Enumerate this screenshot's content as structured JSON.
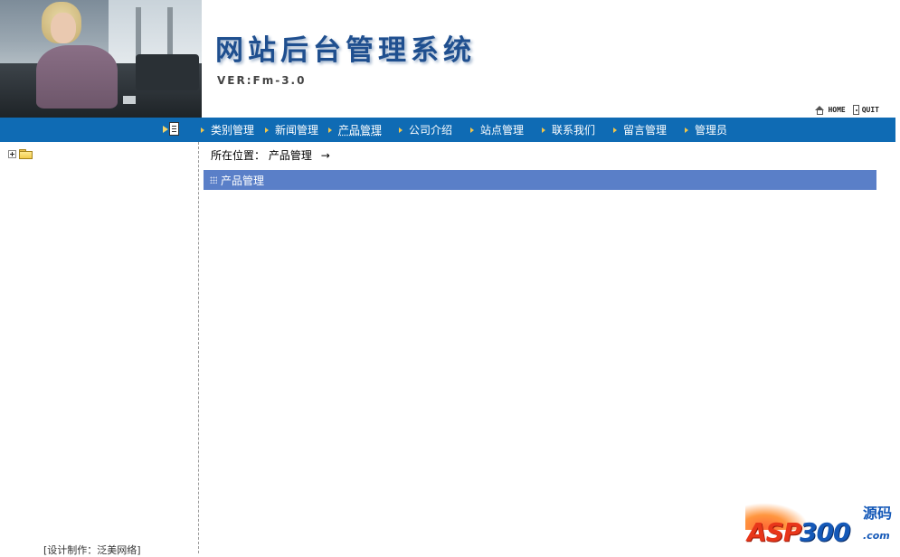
{
  "header": {
    "title": "网站后台管理系统",
    "version": "VER:Fm-3.0",
    "links": [
      {
        "label": "HOME",
        "icon": "home-icon"
      },
      {
        "label": "QUIT",
        "icon": "quit-icon"
      }
    ]
  },
  "nav": {
    "items": [
      {
        "label": "类别管理"
      },
      {
        "label": "新闻管理"
      },
      {
        "label": "产品管理"
      },
      {
        "label": "公司介绍"
      },
      {
        "label": "站点管理"
      },
      {
        "label": "联系我们"
      },
      {
        "label": "留言管理"
      },
      {
        "label": "管理员"
      }
    ],
    "active": "产品管理",
    "colors": {
      "bar": "#0f6bb4",
      "arrow": "#f2c64a",
      "text": "#ffffff"
    }
  },
  "left": {
    "tree_icons": [
      "plus-box-icon",
      "folder-icon"
    ],
    "credit": "[设计制作：泛美网络]"
  },
  "main": {
    "breadcrumb_label": "所在位置：",
    "breadcrumb_current": "产品管理",
    "breadcrumb_arrow": "→",
    "section_title": "产品管理",
    "section_color": "#5a7fc8"
  },
  "watermark": {
    "brand_a": "ASP",
    "brand_b": "300",
    "brand_cn": "源码",
    "brand_suffix": ".com"
  }
}
